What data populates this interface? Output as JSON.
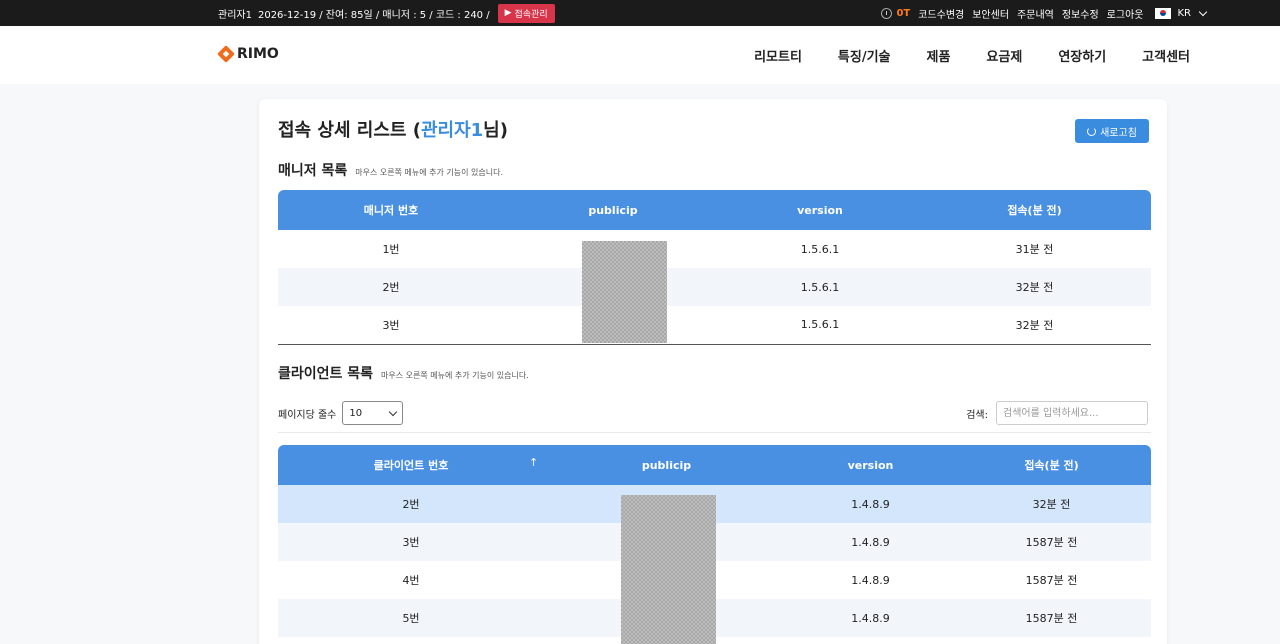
{
  "topbar": {
    "user": "관리자1",
    "info": "2026-12-19 / 잔여: 85일 / 매니저 : 5 / 코드 : 240 /",
    "connect_button": "접속관리",
    "ot_label": "0T",
    "links": [
      "코드수변경",
      "보안센터",
      "주문내역",
      "정보수정",
      "로그아웃"
    ],
    "language": "KR"
  },
  "header": {
    "logo_text": "RIMO",
    "nav": [
      "리모트티",
      "특징/기술",
      "제품",
      "요금제",
      "연장하기",
      "고객센터"
    ]
  },
  "page": {
    "title_prefix": "접속 상세 리스트 (",
    "title_user": "관리자1",
    "title_suffix": "님)",
    "refresh_button": "새로고침"
  },
  "managers": {
    "title": "매니저 목록",
    "hint": "마우스 오른쪽 메뉴에 추가 기능이 있습니다.",
    "columns": [
      "매니저 번호",
      "publicip",
      "version",
      "접속(분 전)"
    ],
    "rows": [
      {
        "num": "1번",
        "ip": "",
        "version": "1.5.6.1",
        "ago": "31분 전"
      },
      {
        "num": "2번",
        "ip": "",
        "version": "1.5.6.1",
        "ago": "32분 전"
      },
      {
        "num": "3번",
        "ip": "",
        "version": "1.5.6.1",
        "ago": "32분 전"
      }
    ]
  },
  "clients": {
    "title": "클라이언트 목록",
    "hint": "마우스 오른쪽 메뉴에 추가 기능이 있습니다.",
    "per_page_label": "페이지당 줄수",
    "per_page_value": "10",
    "search_label": "검색:",
    "search_placeholder": "검색어를 입력하세요...",
    "sort_arrow": "↑",
    "columns": [
      "클라이언트 번호",
      "publicip",
      "version",
      "접속(분 전)"
    ],
    "rows": [
      {
        "num": "2번",
        "ip": "",
        "version": "1.4.8.9",
        "ago": "32분 전"
      },
      {
        "num": "3번",
        "ip": "",
        "version": "1.4.8.9",
        "ago": "1587분 전"
      },
      {
        "num": "4번",
        "ip": "",
        "version": "1.4.8.9",
        "ago": "1587분 전"
      },
      {
        "num": "5번",
        "ip": "",
        "version": "1.4.8.9",
        "ago": "1587분 전"
      }
    ]
  },
  "colors": {
    "accent": "#4a90e2",
    "connect_button": "#d8344a",
    "ot": "#ff7a18",
    "logo": "#f26b1d"
  }
}
